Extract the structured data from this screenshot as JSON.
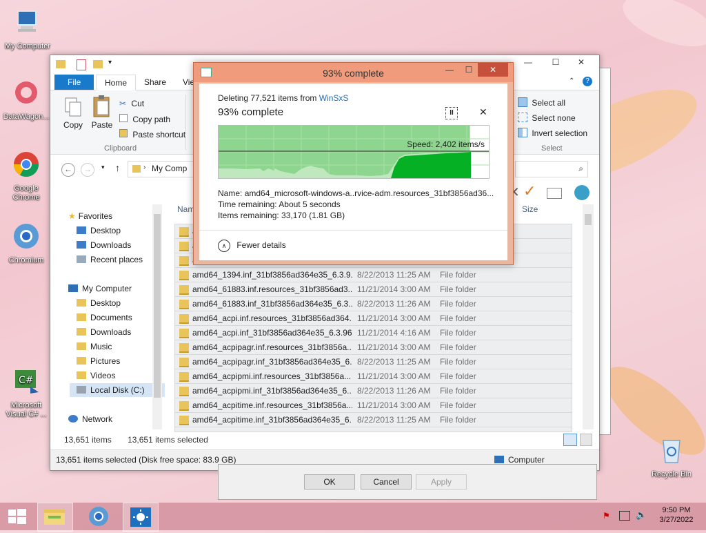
{
  "desktop": {
    "icons": [
      {
        "label": "My Computer"
      },
      {
        "label": "DataWagon..."
      },
      {
        "label": "Google Chrome"
      },
      {
        "label": "Chromium"
      },
      {
        "label": "Microsoft Visual C# ..."
      },
      {
        "label": "Recycle Bin"
      }
    ]
  },
  "explorer": {
    "title_partial": "WinSxS",
    "ribbon_tabs": [
      "File",
      "Home",
      "Share",
      "Vie"
    ],
    "clipboard": {
      "copy": "Copy",
      "paste": "Paste",
      "cut": "Cut",
      "copy_path": "Copy path",
      "paste_shortcut": "Paste shortcut",
      "group_label": "Clipboard"
    },
    "select": {
      "select_all": "Select all",
      "select_none": "Select none",
      "invert_selection": "Invert selection",
      "group_label": "Select"
    },
    "address": "My Comp",
    "nav": {
      "favorites": "Favorites",
      "favorites_items": [
        "Desktop",
        "Downloads",
        "Recent places"
      ],
      "my_computer": "My Computer",
      "computer_items": [
        "Desktop",
        "Documents",
        "Downloads",
        "Music",
        "Pictures",
        "Videos",
        "Local Disk (C:)"
      ],
      "network": "Network"
    },
    "columns": {
      "name": "Nam",
      "size": "Size"
    },
    "rows_partial": [
      "a",
      "a",
      "a"
    ],
    "rows": [
      {
        "name": "amd64_1394.inf_31bf3856ad364e35_6.3.9...",
        "date": "8/22/2013 11:25 AM",
        "type": "File folder"
      },
      {
        "name": "amd64_61883.inf.resources_31bf3856ad3...",
        "date": "11/21/2014 3:00 AM",
        "type": "File folder"
      },
      {
        "name": "amd64_61883.inf_31bf3856ad364e35_6.3....",
        "date": "8/22/2013 11:26 AM",
        "type": "File folder"
      },
      {
        "name": "amd64_acpi.inf.resources_31bf3856ad364...",
        "date": "11/21/2014 3:00 AM",
        "type": "File folder"
      },
      {
        "name": "amd64_acpi.inf_31bf3856ad364e35_6.3.96...",
        "date": "11/21/2014 4:16 AM",
        "type": "File folder"
      },
      {
        "name": "amd64_acpipagr.inf.resources_31bf3856a...",
        "date": "11/21/2014 3:00 AM",
        "type": "File folder"
      },
      {
        "name": "amd64_acpipagr.inf_31bf3856ad364e35_6...",
        "date": "8/22/2013 11:25 AM",
        "type": "File folder"
      },
      {
        "name": "amd64_acpipmi.inf.resources_31bf3856a...",
        "date": "11/21/2014 3:00 AM",
        "type": "File folder"
      },
      {
        "name": "amd64_acpipmi.inf_31bf3856ad364e35_6....",
        "date": "8/22/2013 11:26 AM",
        "type": "File folder"
      },
      {
        "name": "amd64_acpitime.inf.resources_31bf3856a...",
        "date": "11/21/2014 3:00 AM",
        "type": "File folder"
      },
      {
        "name": "amd64_acpitime.inf_31bf3856ad364e35_6...",
        "date": "8/22/2013 11:25 AM",
        "type": "File folder"
      }
    ],
    "status": {
      "items": "13,651 items",
      "selected": "13,651 items selected",
      "bottom": "13,651 items selected (Disk free space: 83.9 GB)",
      "computer": "Computer"
    }
  },
  "back_dialog": {
    "ok": "OK",
    "cancel": "Cancel",
    "apply": "Apply"
  },
  "progress": {
    "title": "93% complete",
    "deleting_prefix": "Deleting 77,521 items from",
    "deleting_link": "WinSxS",
    "heading": "93% complete",
    "percent": 93,
    "speed": "Speed: 2,402 items/s",
    "name_label": "Name:",
    "name_value": "amd64_microsoft-windows-a..rvice-adm.resources_31bf3856ad36...",
    "time_label": "Time remaining:",
    "time_value": "About 5 seconds",
    "items_label": "Items remaining:",
    "items_value": "33,170 (1.81 GB)",
    "fewer_details": "Fewer details"
  },
  "taskbar": {
    "time": "9:50 PM",
    "date": "3/27/2022"
  },
  "colors": {
    "accent": "#1979ca",
    "progress_green": "#06b025",
    "progress_bg": "#8ed68f",
    "dialog_title": "#f09b7b"
  }
}
